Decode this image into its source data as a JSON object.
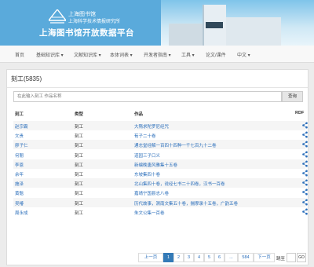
{
  "banner": {
    "logo_line1": "上海图书馆",
    "logo_line2": "上海科学技术情报研究所",
    "site_title": "上海图书馆开放数据平台"
  },
  "nav": {
    "items": [
      "首页",
      "基础知识库 ▾",
      "文献知识库 ▾",
      "本体词表 ▾",
      "开发者指南 ▾",
      "工具 ▾",
      "论文/课件",
      "中文 ▾"
    ]
  },
  "panel": {
    "title": "刻工(5835)",
    "search_placeholder": "在此输入刻工 作品名称",
    "search_button": "查询"
  },
  "table": {
    "headers": [
      "刻工",
      "类型",
      "作品",
      "RDF"
    ],
    "rows": [
      {
        "name": "赵宗霸",
        "type": "刻工",
        "work": "大隋求陀罗尼经咒"
      },
      {
        "name": "文贵",
        "type": "刻工",
        "work": "荀子二十卷"
      },
      {
        "name": "廖子仁",
        "type": "刻工",
        "work": "通志堂经解一百四十四种一千七百九十二卷"
      },
      {
        "name": "何閒",
        "type": "刻工",
        "work": "道园三子口义"
      },
      {
        "name": "李恩",
        "type": "刻工",
        "work": "新编晚唐风雅集十五卷"
      },
      {
        "name": "余年",
        "type": "刻工",
        "work": "东坡集四十卷"
      },
      {
        "name": "施泽",
        "type": "刻工",
        "work": "北山集四十卷，说经七书二十四卷，汉书一百卷"
      },
      {
        "name": "黄魁",
        "type": "刻工",
        "work": "嘉靖宁国县志八卷"
      },
      {
        "name": "吴椿",
        "type": "刻工",
        "work": "历代故事，渭南文集五十卷，揣摩录十五卷，广韵五卷"
      },
      {
        "name": "周永成",
        "type": "刻工",
        "work": "朱文公集一百卷"
      }
    ]
  },
  "pagination": {
    "prev": "上一页",
    "pages": [
      "1",
      "2",
      "3",
      "4",
      "5",
      "6",
      "...",
      "584"
    ],
    "next": "下一页",
    "current_page": 1,
    "jump_label": "跳至",
    "go": "GO"
  },
  "colors": {
    "accent": "#337ab7",
    "link": "#2a6ebb",
    "banner": "#5aaadb"
  },
  "icons": {
    "share": "share-icon",
    "logo": "peak-logo-icon"
  }
}
